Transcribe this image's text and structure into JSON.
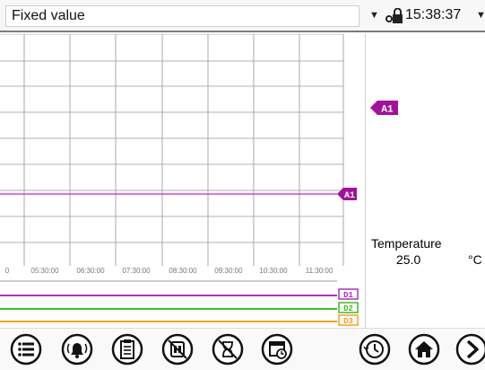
{
  "header": {
    "mode_label": "Fixed value",
    "time": "15:38:37"
  },
  "chart_data": {
    "type": "line",
    "x_tick_labels": [
      "0",
      "05:30:00",
      "06:30:00",
      "07:30:00",
      "08:30:00",
      "09:30:00",
      "10:30:00",
      "11:30:00"
    ],
    "series": [
      {
        "name": "A1",
        "color": "#cc22cc"
      }
    ],
    "grid": true
  },
  "digital_channels": [
    {
      "name": "D1",
      "color": "#aa33bb"
    },
    {
      "name": "D2",
      "color": "#44bb22"
    },
    {
      "name": "D3",
      "color": "#f0a020"
    }
  ],
  "tags": {
    "chart_marker": "A1",
    "panel_marker": "A1"
  },
  "readout": {
    "label": "Temperature",
    "value": "25.0",
    "unit": "°C"
  },
  "toolbar": {
    "buttons": [
      {
        "icon": "menu-list-icon"
      },
      {
        "icon": "alarm-bell-icon"
      },
      {
        "icon": "clipboard-icon"
      },
      {
        "icon": "program-stop-icon"
      },
      {
        "icon": "timer-off-icon"
      },
      {
        "icon": "scheduler-icon"
      },
      {
        "icon": "clock-cycle-icon"
      },
      {
        "icon": "home-icon"
      },
      {
        "icon": "next-arrow-icon"
      }
    ]
  },
  "colors": {
    "accent": "#a0129a",
    "channel1": "#aa33bb",
    "channel2": "#44bb22",
    "channel3": "#f0a020"
  }
}
